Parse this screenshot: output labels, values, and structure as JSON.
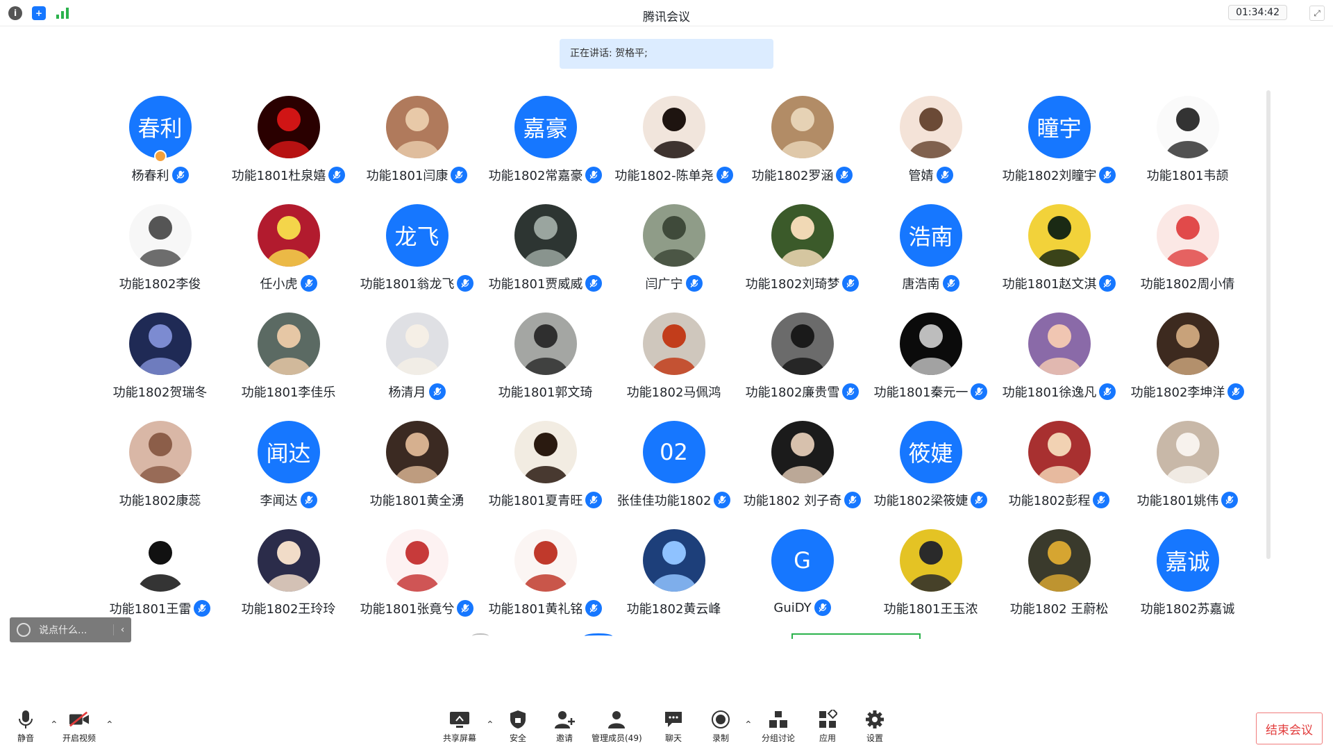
{
  "window": {
    "title": "腾讯会议",
    "timer": "01:34:42"
  },
  "speaking": {
    "text": "正在讲话: 贺格平;"
  },
  "colors": {
    "accent": "#1677ff",
    "end": "#e23c3c"
  },
  "participants": [
    {
      "name": "杨春利",
      "avatar_text": "春利",
      "avatar": "text",
      "mic": true,
      "host": true
    },
    {
      "name": "功能1801杜泉嬉",
      "avatar": "img",
      "bg": "#2a0000",
      "fg": "#d01515",
      "mic": true
    },
    {
      "name": "功能1801闫康",
      "avatar": "img",
      "bg": "#b07a5c",
      "fg": "#e8c9a8",
      "mic": true
    },
    {
      "name": "功能1802常嘉豪",
      "avatar_text": "嘉豪",
      "avatar": "text",
      "mic": true
    },
    {
      "name": "功能1802-陈单尧",
      "avatar": "img",
      "bg": "#f1e5dc",
      "fg": "#1e1410",
      "mic": true
    },
    {
      "name": "功能1802罗涵",
      "avatar": "img",
      "bg": "#b28c66",
      "fg": "#e6d2b5",
      "mic": true
    },
    {
      "name": "管婧",
      "avatar": "img",
      "bg": "#f4e3d8",
      "fg": "#6b4a36",
      "mic": true
    },
    {
      "name": "功能1802刘瞳宇",
      "avatar_text": "瞳宇",
      "avatar": "text",
      "mic": true
    },
    {
      "name": "功能1801韦颉",
      "avatar": "img",
      "bg": "#fafafa",
      "fg": "#333333",
      "mic": false
    },
    {
      "name": "功能1802李俊",
      "avatar": "img",
      "bg": "#f7f7f7",
      "fg": "#555555",
      "mic": false
    },
    {
      "name": "任小虎",
      "avatar": "img",
      "bg": "#b21b2e",
      "fg": "#f4d54a",
      "mic": true
    },
    {
      "name": "功能1801翁龙飞",
      "avatar_text": "龙飞",
      "avatar": "text",
      "mic": true
    },
    {
      "name": "功能1801贾威威",
      "avatar": "img",
      "bg": "#2d3532",
      "fg": "#9aa59f",
      "mic": true
    },
    {
      "name": "闫广宁",
      "avatar": "img",
      "bg": "#8f9c88",
      "fg": "#3f4a3a",
      "mic": true
    },
    {
      "name": "功能1802刘琦梦",
      "avatar": "img",
      "bg": "#3b5a2a",
      "fg": "#f1d9b5",
      "mic": true
    },
    {
      "name": "唐浩南",
      "avatar_text": "浩南",
      "avatar": "text",
      "mic": true
    },
    {
      "name": "功能1801赵文淇",
      "avatar": "img",
      "bg": "#f2d23a",
      "fg": "#1a2a14",
      "mic": true
    },
    {
      "name": "功能1802周小倩",
      "avatar": "img",
      "bg": "#fbe8e5",
      "fg": "#e14a4a",
      "mic": false
    },
    {
      "name": "功能1802贺瑞冬",
      "avatar": "img",
      "bg": "#1f2a55",
      "fg": "#7c8bd1",
      "mic": false
    },
    {
      "name": "功能1801李佳乐",
      "avatar": "img",
      "bg": "#5b6a63",
      "fg": "#e6c7a5",
      "mic": false
    },
    {
      "name": "杨清月",
      "avatar": "img",
      "bg": "#dfe0e4",
      "fg": "#f5efe6",
      "mic": true
    },
    {
      "name": "功能1801郭文琦",
      "avatar": "img",
      "bg": "#a4a6a3",
      "fg": "#2f2f2f",
      "mic": false
    },
    {
      "name": "功能1802马佩鸿",
      "avatar": "img",
      "bg": "#cfc7bd",
      "fg": "#c23d1b",
      "mic": false
    },
    {
      "name": "功能1802廉贵雪",
      "avatar": "img",
      "bg": "#6b6b6b",
      "fg": "#1a1a1a",
      "mic": true
    },
    {
      "name": "功能1801秦元一",
      "avatar": "img",
      "bg": "#0b0b0b",
      "fg": "#bdbdbd",
      "mic": true
    },
    {
      "name": "功能1801徐逸凡",
      "avatar": "img",
      "bg": "#8a6aa8",
      "fg": "#f0c6b2",
      "mic": true
    },
    {
      "name": "功能1802李坤洋",
      "avatar": "img",
      "bg": "#3d2a1f",
      "fg": "#c8a27a",
      "mic": true
    },
    {
      "name": "功能1802康蕊",
      "avatar": "img",
      "bg": "#d9b7a6",
      "fg": "#8c5e49",
      "mic": false
    },
    {
      "name": "李闻达",
      "avatar_text": "闻达",
      "avatar": "text",
      "mic": true
    },
    {
      "name": "功能1801黄全湧",
      "avatar": "img",
      "bg": "#3b2a22",
      "fg": "#d6b08f",
      "mic": false
    },
    {
      "name": "功能1801夏青旺",
      "avatar": "img",
      "bg": "#f2ece2",
      "fg": "#2a1a10",
      "mic": true
    },
    {
      "name": "张佳佳功能1802",
      "avatar_text": "02",
      "avatar": "text",
      "mic": true
    },
    {
      "name": "功能1802 刘子奇",
      "avatar": "img",
      "bg": "#1b1b1b",
      "fg": "#d7c1ad",
      "mic": true
    },
    {
      "name": "功能1802梁筱婕",
      "avatar_text": "筱婕",
      "avatar": "text",
      "mic": true
    },
    {
      "name": "功能1802彭程",
      "avatar": "img",
      "bg": "#a83030",
      "fg": "#f2d2b3",
      "mic": true
    },
    {
      "name": "功能1801姚伟",
      "avatar": "img",
      "bg": "#c8b8a8",
      "fg": "#f7f2ed",
      "mic": true
    },
    {
      "name": "功能1801王雷",
      "avatar": "img",
      "bg": "#ffffff",
      "fg": "#111111",
      "mic": true
    },
    {
      "name": "功能1802王玲玲",
      "avatar": "img",
      "bg": "#2b2c4a",
      "fg": "#f1dcc8",
      "mic": false
    },
    {
      "name": "功能1801张竟兮",
      "avatar": "img",
      "bg": "#fdf2f2",
      "fg": "#c73a3a",
      "mic": true
    },
    {
      "name": "功能1801黄礼铭",
      "avatar": "img",
      "bg": "#fbf5f3",
      "fg": "#c0392b",
      "mic": true
    },
    {
      "name": "功能1802黄云峰",
      "avatar": "img",
      "bg": "#1d3f7a",
      "fg": "#8fc2ff",
      "mic": false
    },
    {
      "name": "GuiDY",
      "avatar_text": "G",
      "avatar": "text",
      "mic": true
    },
    {
      "name": "功能1801王玉浓",
      "avatar": "img",
      "bg": "#e4c324",
      "fg": "#2a2a2a",
      "mic": false
    },
    {
      "name": "功能1802 王蔚松",
      "avatar": "img",
      "bg": "#3a3a2c",
      "fg": "#d6a531",
      "mic": false
    },
    {
      "name": "功能1802苏嘉诚",
      "avatar_text": "嘉诚",
      "avatar": "text",
      "mic": false
    }
  ],
  "chat": {
    "placeholder": "说点什么..."
  },
  "toolbar": {
    "mute": "静音",
    "video": "开启视频",
    "share": "共享屏幕",
    "security": "安全",
    "invite": "邀请",
    "members": "管理成员(49)",
    "chat": "聊天",
    "record": "录制",
    "breakout": "分组讨论",
    "apps": "应用",
    "settings": "设置",
    "end": "结束会议"
  }
}
